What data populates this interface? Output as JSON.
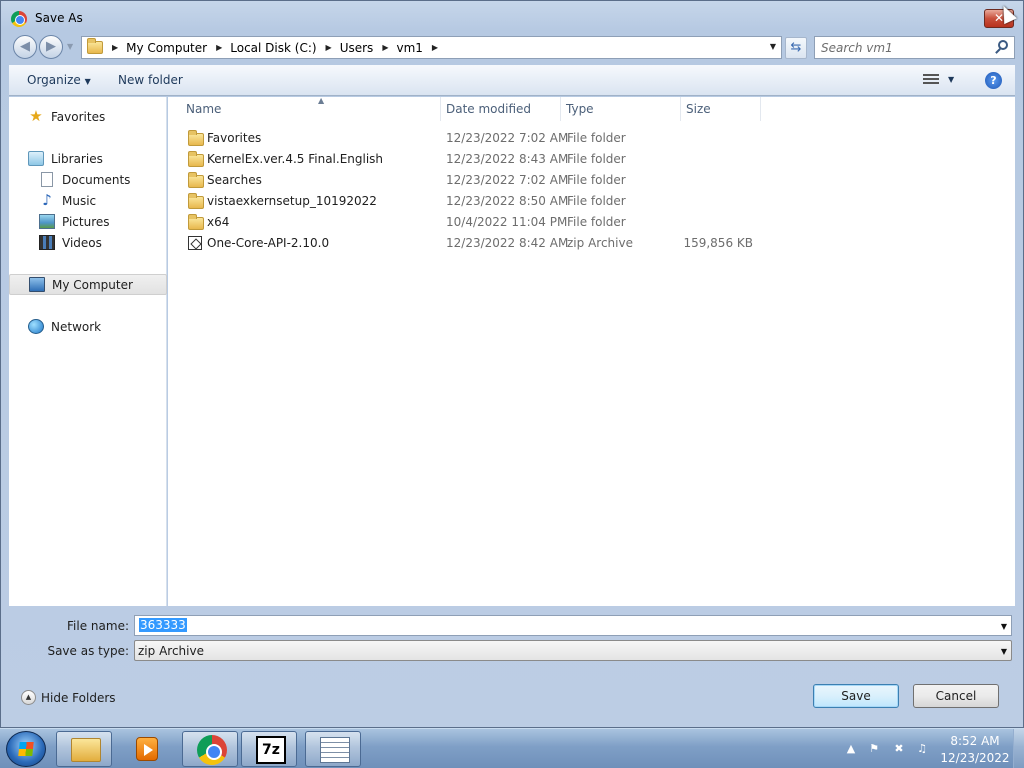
{
  "window": {
    "title": "Save As",
    "close_glyph": "✕"
  },
  "nav": {
    "back_glyph": "◀",
    "forward_glyph": "▶",
    "breadcrumbs": [
      "My Computer",
      "Local Disk (C:)",
      "Users",
      "vm1"
    ],
    "search_placeholder": "Search vm1"
  },
  "toolbar": {
    "organize_label": "Organize",
    "new_folder_label": "New folder",
    "help_glyph": "?"
  },
  "sidebar": {
    "favorites": "Favorites",
    "libraries": "Libraries",
    "documents": "Documents",
    "music": "Music",
    "pictures": "Pictures",
    "videos": "Videos",
    "my_computer": "My Computer",
    "network": "Network"
  },
  "columns": {
    "name": "Name",
    "date_modified": "Date modified",
    "type": "Type",
    "size": "Size"
  },
  "files": [
    {
      "name": "Favorites",
      "date": "12/23/2022 7:02 AM",
      "type": "File folder",
      "size": "",
      "icon": "folder-star-icon"
    },
    {
      "name": "KernelEx.ver.4.5 Final.English",
      "date": "12/23/2022 8:43 AM",
      "type": "File folder",
      "size": "",
      "icon": "folder-icon"
    },
    {
      "name": "Searches",
      "date": "12/23/2022 7:02 AM",
      "type": "File folder",
      "size": "",
      "icon": "folder-search-icon"
    },
    {
      "name": "vistaexkernsetup_10192022",
      "date": "12/23/2022 8:50 AM",
      "type": "File folder",
      "size": "",
      "icon": "folder-icon"
    },
    {
      "name": "x64",
      "date": "10/4/2022 11:04 PM",
      "type": "File folder",
      "size": "",
      "icon": "folder-icon"
    },
    {
      "name": "One-Core-API-2.10.0",
      "date": "12/23/2022 8:42 AM",
      "type": "zip Archive",
      "size": "159,856 KB",
      "icon": "zip-icon"
    }
  ],
  "form": {
    "file_name_label": "File name:",
    "file_name_value": "363333",
    "save_type_label": "Save as type:",
    "save_type_value": "zip Archive",
    "hide_folders_label": "Hide Folders",
    "save_label": "Save",
    "cancel_label": "Cancel"
  },
  "taskbar": {
    "time": "8:52 AM",
    "date": "12/23/2022",
    "seven_zip_label": "7z"
  }
}
